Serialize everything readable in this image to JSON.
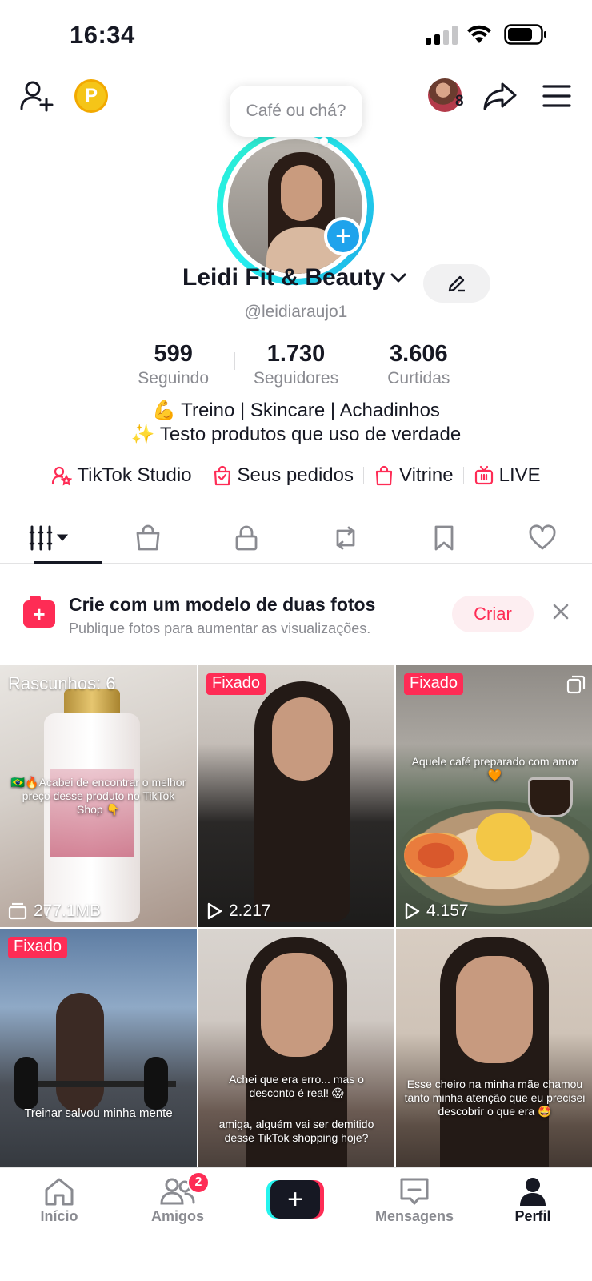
{
  "status_bar": {
    "time": "16:34"
  },
  "top_bar": {
    "coin_label": "P",
    "story_count": "8"
  },
  "avatar": {
    "note": "Café ou chá?",
    "add_label": "+"
  },
  "profile": {
    "name": "Leidi Fit & Beauty",
    "handle": "@leidiaraujo1",
    "stats": [
      {
        "value": "599",
        "label": "Seguindo"
      },
      {
        "value": "1.730",
        "label": "Seguidores"
      },
      {
        "value": "3.606",
        "label": "Curtidas"
      }
    ],
    "bio": [
      "💪 Treino | Skincare | Achadinhos",
      "✨ Testo produtos que uso de verdade"
    ]
  },
  "links": [
    {
      "label": "TikTok Studio",
      "icon": "person-star-icon"
    },
    {
      "label": "Seus pedidos",
      "icon": "shopping-bag-check-icon"
    },
    {
      "label": "Vitrine",
      "icon": "shopping-bag-icon"
    },
    {
      "label": "LIVE",
      "icon": "tv-icon"
    }
  ],
  "tabs": [
    {
      "icon": "grid-icon",
      "active": true
    },
    {
      "icon": "shopping-bag-icon"
    },
    {
      "icon": "lock-icon"
    },
    {
      "icon": "repost-icon"
    },
    {
      "icon": "bookmark-icon"
    },
    {
      "icon": "heart-icon"
    }
  ],
  "promo": {
    "title": "Crie com um modelo de duas fotos",
    "subtitle": "Publique fotos para aumentar as visualizações.",
    "button": "Criar"
  },
  "grid": [
    {
      "label": "Rascunhos: 6",
      "overlay": "🇧🇷🔥Acabei de encontrar o melhor preço desse produto no TikTok Shop 👇",
      "metric": "277.1MB",
      "metric_icon": "storage-icon"
    },
    {
      "label": "Fixado",
      "metric": "2.217",
      "metric_icon": "play-icon"
    },
    {
      "label": "Fixado",
      "overlay": "Aquele café preparado com amor 🧡",
      "metric": "4.157",
      "metric_icon": "play-icon"
    },
    {
      "label": "Fixado",
      "overlay": "Treinar salvou minha mente"
    },
    {
      "overlay": "Achei que era erro... mas o desconto é real! 😱",
      "overlay2": "amiga, alguém vai ser demitido desse TikTok shopping hoje?"
    },
    {
      "overlay": "Esse cheiro na minha mãe chamou tanto minha atenção que eu precisei descobrir o que era 🤩"
    }
  ],
  "bottom_nav": [
    {
      "label": "Início",
      "icon": "home-icon"
    },
    {
      "label": "Amigos",
      "icon": "friends-icon",
      "badge": "2"
    },
    {
      "label": "",
      "icon": "plus-icon"
    },
    {
      "label": "Mensagens",
      "icon": "message-icon"
    },
    {
      "label": "Perfil",
      "icon": "profile-icon",
      "active": true
    }
  ],
  "colors": {
    "accent": "#fe2c55",
    "teal": "#25f4ee",
    "text": "#161823",
    "muted": "#8a8b91"
  }
}
